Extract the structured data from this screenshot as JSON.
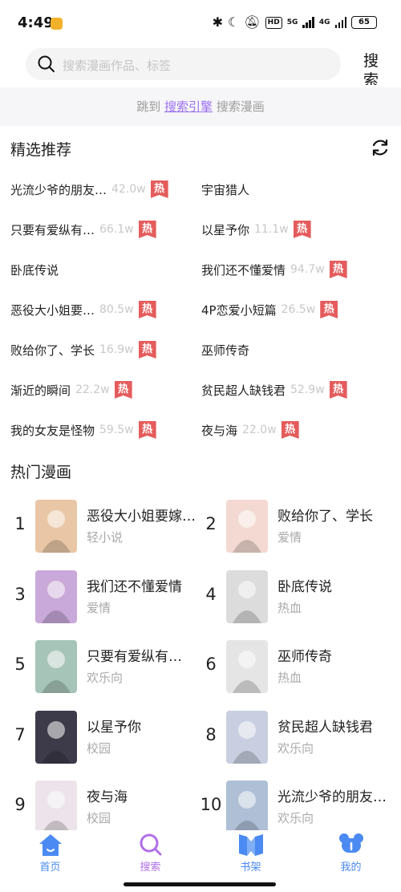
{
  "status_bar": {
    "time": "4:49",
    "net_5g": "5G",
    "net_4g": "4G",
    "battery": "65",
    "hd": "HD"
  },
  "search": {
    "placeholder": "搜索漫画作品、标签",
    "button_label": "搜索"
  },
  "engine": {
    "prefix": "跳到",
    "link": "搜索引擎",
    "suffix": "搜索漫画"
  },
  "recommend": {
    "title": "精选推荐",
    "items": [
      {
        "name": "光流少爷的朋友…",
        "count": "42.0w",
        "hot": true
      },
      {
        "name": "宇宙猎人",
        "count": "",
        "hot": false
      },
      {
        "name": "只要有爱纵有…",
        "count": "66.1w",
        "hot": true
      },
      {
        "name": "以星予你",
        "count": "11.1w",
        "hot": true
      },
      {
        "name": "卧底传说",
        "count": "",
        "hot": false
      },
      {
        "name": "我们还不懂爱情",
        "count": "94.7w",
        "hot": true
      },
      {
        "name": "恶役大小姐要…",
        "count": "80.5w",
        "hot": true
      },
      {
        "name": "4P恋爱小短篇",
        "count": "26.5w",
        "hot": true
      },
      {
        "name": "败给你了、学长",
        "count": "16.9w",
        "hot": true
      },
      {
        "name": "巫师传奇",
        "count": "",
        "hot": false
      },
      {
        "name": "渐近的瞬间",
        "count": "22.2w",
        "hot": true
      },
      {
        "name": "贫民超人缺钱君",
        "count": "52.9w",
        "hot": true
      },
      {
        "name": "我的女友是怪物",
        "count": "59.5w",
        "hot": true
      },
      {
        "name": "夜与海",
        "count": "22.0w",
        "hot": true
      }
    ],
    "hot_label": "热"
  },
  "hot_comics": {
    "title": "热门漫画",
    "items": [
      {
        "rank": "1",
        "title": "恶役大小姐要嫁给…",
        "genre": "轻小说",
        "cover": "#e9c7a6"
      },
      {
        "rank": "2",
        "title": "败给你了、学长",
        "genre": "爱情",
        "cover": "#f4d9d2"
      },
      {
        "rank": "3",
        "title": "我们还不懂爱情",
        "genre": "爱情",
        "cover": "#c9a9d9"
      },
      {
        "rank": "4",
        "title": "卧底传说",
        "genre": "热血",
        "cover": "#dcdcdc"
      },
      {
        "rank": "5",
        "title": "只要有爱纵有…",
        "genre": "欢乐向",
        "cover": "#a7c4b8"
      },
      {
        "rank": "6",
        "title": "巫师传奇",
        "genre": "热血",
        "cover": "#e5e5e5"
      },
      {
        "rank": "7",
        "title": "以星予你",
        "genre": "校园",
        "cover": "#3d3a4a"
      },
      {
        "rank": "8",
        "title": "贫民超人缺钱君",
        "genre": "欢乐向",
        "cover": "#c9cfe0"
      },
      {
        "rank": "9",
        "title": "夜与海",
        "genre": "校园",
        "cover": "#ece4ea"
      },
      {
        "rank": "10",
        "title": "光流少爷的朋友…",
        "genre": "欢乐向",
        "cover": "#aebfd6"
      }
    ]
  },
  "tabs": [
    {
      "label": "首页",
      "color": "#4a8af2"
    },
    {
      "label": "搜索",
      "color": "#b16fe8"
    },
    {
      "label": "书架",
      "color": "#4a8af2"
    },
    {
      "label": "我的",
      "color": "#4a8af2"
    }
  ]
}
